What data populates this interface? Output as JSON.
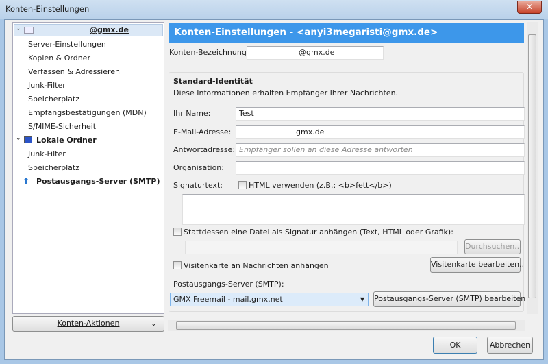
{
  "window": {
    "title": "Konten-Einstellungen",
    "close_glyph": "✕"
  },
  "tree": {
    "account": "@gmx.de",
    "account_items": [
      "Server-Einstellungen",
      "Kopien & Ordner",
      "Verfassen & Adressieren",
      "Junk-Filter",
      "Speicherplatz",
      "Empfangsbestätigungen (MDN)",
      "S/MIME-Sicherheit"
    ],
    "local": "Lokale Ordner",
    "local_items": [
      "Junk-Filter",
      "Speicherplatz"
    ],
    "smtp": "Postausgangs-Server (SMTP)"
  },
  "account_actions": "Konten-Aktionen",
  "header": {
    "title": "Konten-Einstellungen - <anyi3megaristi@gmx.de>",
    "color": "#3d97ea"
  },
  "form": {
    "account_name_label": "Konten-Bezeichnung:",
    "account_name_value": "@gmx.de",
    "identity_title": "Standard-Identität",
    "identity_desc": "Diese Informationen erhalten Empfänger Ihrer Nachrichten.",
    "name_label": "Ihr Name:",
    "name_value": "Test",
    "email_label": "E-Mail-Adresse:",
    "email_value": "gmx.de",
    "reply_label": "Antwortadresse:",
    "reply_placeholder": "Empfänger sollen an diese Adresse antworten",
    "org_label": "Organisation:",
    "org_value": "",
    "sig_label": "Signaturtext:",
    "html_checkbox": "HTML verwenden (z.B.: <b>fett</b>)",
    "sig_file_checkbox": "Stattdessen eine Datei als Signatur anhängen (Text, HTML oder Grafik):",
    "browse": "Durchsuchen...",
    "vcard_checkbox": "Visitenkarte an Nachrichten anhängen",
    "vcard_edit": "Visitenkarte bearbeiten...",
    "smtp_label": "Postausgangs-Server (SMTP):",
    "smtp_value": "GMX Freemail - mail.gmx.net",
    "smtp_edit": "Postausgangs-Server (SMTP) bearbeiten..."
  },
  "buttons": {
    "ok": "OK",
    "cancel": "Abbrechen"
  }
}
